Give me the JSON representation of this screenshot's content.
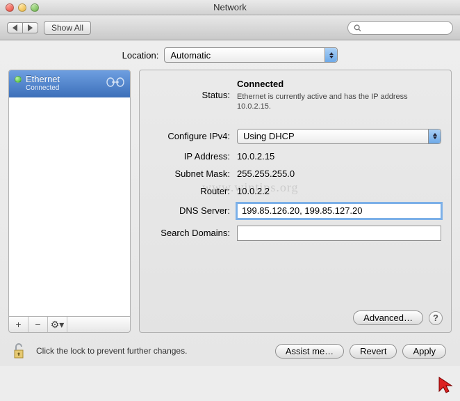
{
  "window": {
    "title": "Network"
  },
  "toolbar": {
    "show_all": "Show All",
    "search_placeholder": ""
  },
  "location": {
    "label": "Location:",
    "value": "Automatic"
  },
  "sidebar": {
    "items": [
      {
        "name": "Ethernet",
        "sub": "Connected",
        "selected": true
      }
    ],
    "footer": {
      "add": "+",
      "remove": "−",
      "gear": "⚙︎▾"
    }
  },
  "detail": {
    "status_label": "Status:",
    "status_value": "Connected",
    "status_desc": "Ethernet is currently active and has the IP address 10.0.2.15.",
    "config_label": "Configure IPv4:",
    "config_value": "Using DHCP",
    "ip_label": "IP Address:",
    "ip_value": "10.0.2.15",
    "subnet_label": "Subnet Mask:",
    "subnet_value": "255.255.255.0",
    "router_label": "Router:",
    "router_value": "10.0.2.2",
    "dns_label": "DNS Server:",
    "dns_value": "199.85.126.20, 199.85.127.20",
    "search_label": "Search Domains:",
    "search_value": "",
    "advanced": "Advanced…",
    "help": "?"
  },
  "watermark": "www.wintips.org",
  "bottom": {
    "lock_text": "Click the lock to prevent further changes.",
    "assist": "Assist me…",
    "revert": "Revert",
    "apply": "Apply"
  }
}
